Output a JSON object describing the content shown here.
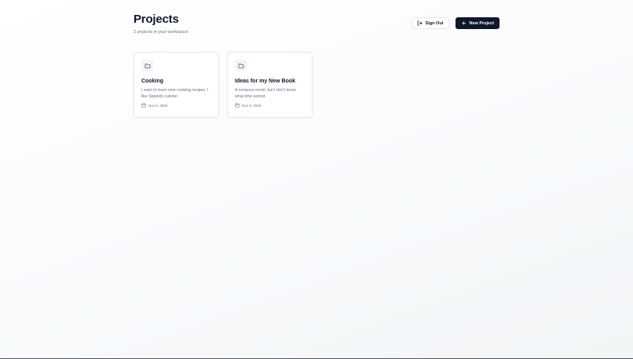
{
  "header": {
    "title": "Projects",
    "subtitle": "2 projects in your workspace",
    "sign_out_label": "Sign Out",
    "new_project_label": "New Project"
  },
  "projects": [
    {
      "title": "Cooking",
      "description": "I want to learn new cooking recipes. I like Spanish cuisine.",
      "date": "Nov 9, 2025",
      "icon": "folder-icon"
    },
    {
      "title": "Ideas for my New Book",
      "description": "A romance novel, but I don't know what time period.",
      "date": "Nov 9, 2025",
      "icon": "folder-icon"
    }
  ],
  "colors": {
    "primary": "#0f172a",
    "muted_text": "#6b7280",
    "border": "#e5e7eb",
    "icon_badge": "#f1f5f9"
  }
}
